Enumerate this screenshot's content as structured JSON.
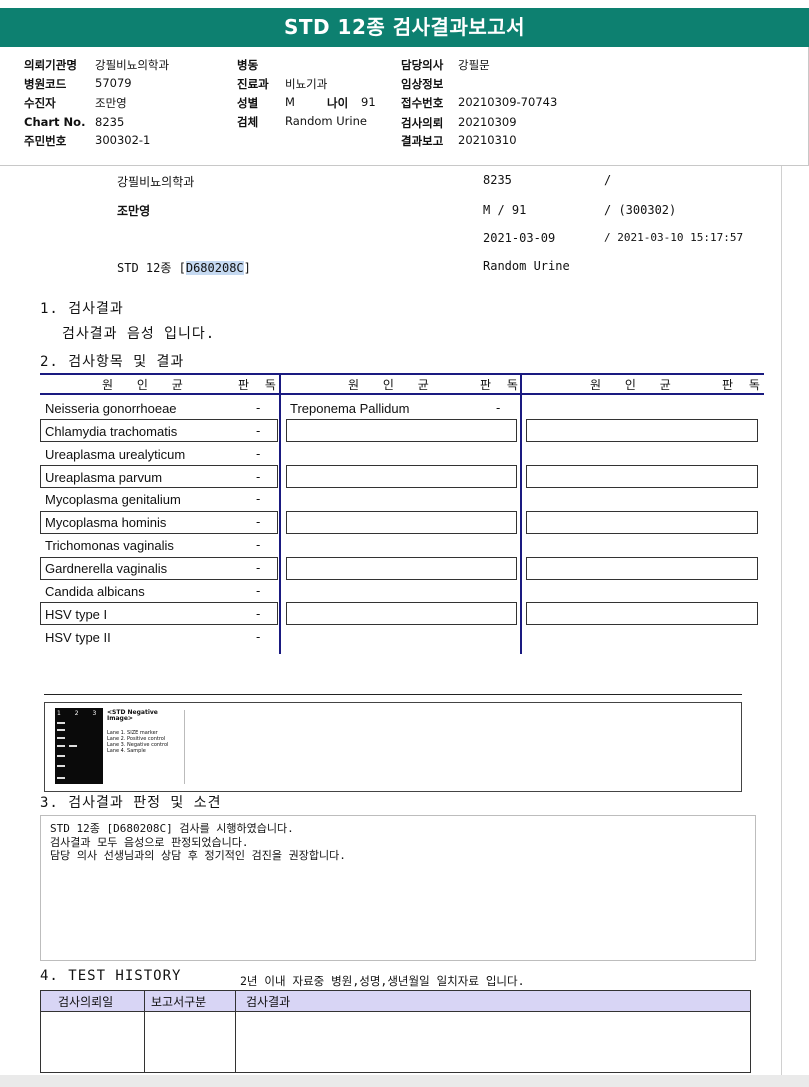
{
  "report": {
    "title": "STD 12종 검사결과보고서"
  },
  "header": {
    "institution_label": "의뢰기관명",
    "institution": "강필비뇨의학과",
    "hospital_code_label": "병원코드",
    "hospital_code": "57079",
    "patient_label": "수진자",
    "patient": "조만영",
    "chart_label": "Chart No.",
    "chart_no": "8235",
    "resident_label": "주민번호",
    "resident_no": "300302-1",
    "ward_label": "병동",
    "ward": "",
    "department_label": "진료과",
    "department": "비뇨기과",
    "sex_label": "성별",
    "sex": "M",
    "age_label": "나이",
    "age": "91",
    "specimen_label": "검체",
    "specimen": "Random Urine",
    "doctor_label": "담당의사",
    "doctor": "강필문",
    "clinical_label": "임상정보",
    "clinical": "",
    "receipt_label": "접수번호",
    "receipt_no": "20210309-70743",
    "request_label": "검사의뢰",
    "request_date": "20210309",
    "report_label": "결과보고",
    "report_date": "20210310"
  },
  "summary": {
    "clinic": "강필비뇨의학과",
    "chart": "8235",
    "slash1": "/",
    "name": "조만영",
    "sex_age": "M  /  91",
    "resident": "/ (300302)",
    "request_date": "2021-03-09",
    "report_time": "/ 2021-03-10 15:17:57",
    "test_name": "STD 12종 [",
    "test_code": "D680208C",
    "test_close": "]",
    "specimen": "Random Urine"
  },
  "section1": {
    "heading": "1. 검사결과",
    "text": "검사결과 음성 입니다."
  },
  "section2": {
    "heading": "2. 검사항목 및 결과",
    "col_pathogen": "원 인 균",
    "col_result": "판 독",
    "col1": [
      {
        "name": "Neisseria gonorrhoeae",
        "result": "-"
      },
      {
        "name": "Chlamydia trachomatis",
        "result": "-"
      },
      {
        "name": "Ureaplasma urealyticum",
        "result": "-"
      },
      {
        "name": "Ureaplasma parvum",
        "result": "-"
      },
      {
        "name": "Mycoplasma genitalium",
        "result": "-"
      },
      {
        "name": "Mycoplasma hominis",
        "result": "-"
      },
      {
        "name": "Trichomonas vaginalis",
        "result": "-"
      },
      {
        "name": "Gardnerella vaginalis",
        "result": "-"
      },
      {
        "name": "Candida albicans",
        "result": "-"
      },
      {
        "name": "HSV type I",
        "result": "-"
      },
      {
        "name": "HSV type II",
        "result": "-"
      }
    ],
    "col2": [
      {
        "name": "Treponema Pallidum",
        "result": "-"
      }
    ]
  },
  "gel_image": {
    "lanes": "1 2 3 4",
    "title": "<STD Negative Image>",
    "legend": [
      "Lane 1. SIZE marker",
      "Lane 2. Positive control",
      "Lane 3. Negative control",
      "Lane 4. Sample"
    ]
  },
  "section3": {
    "heading": "3. 검사결과 판정 및 소견",
    "lines": [
      "STD 12종 [D680208C] 검사를 시행하였습니다.",
      "검사결과 모두 음성으로 판정되었습니다.",
      "담당 의사 선생님과의 상담 후 정기적인 검진을 권장합니다."
    ]
  },
  "section4": {
    "heading": "4. TEST HISTORY",
    "note": "2년 이내 자료중 병원,성명,생년월일 일치자료 입니다.",
    "col_request": "검사의뢰일",
    "col_type": "보고서구분",
    "col_result": "검사결과"
  },
  "colors": {
    "banner": "#0d8070",
    "rule": "#1a1a80",
    "history_header": "#d8d5f5",
    "highlight": "#c5d9f1"
  }
}
